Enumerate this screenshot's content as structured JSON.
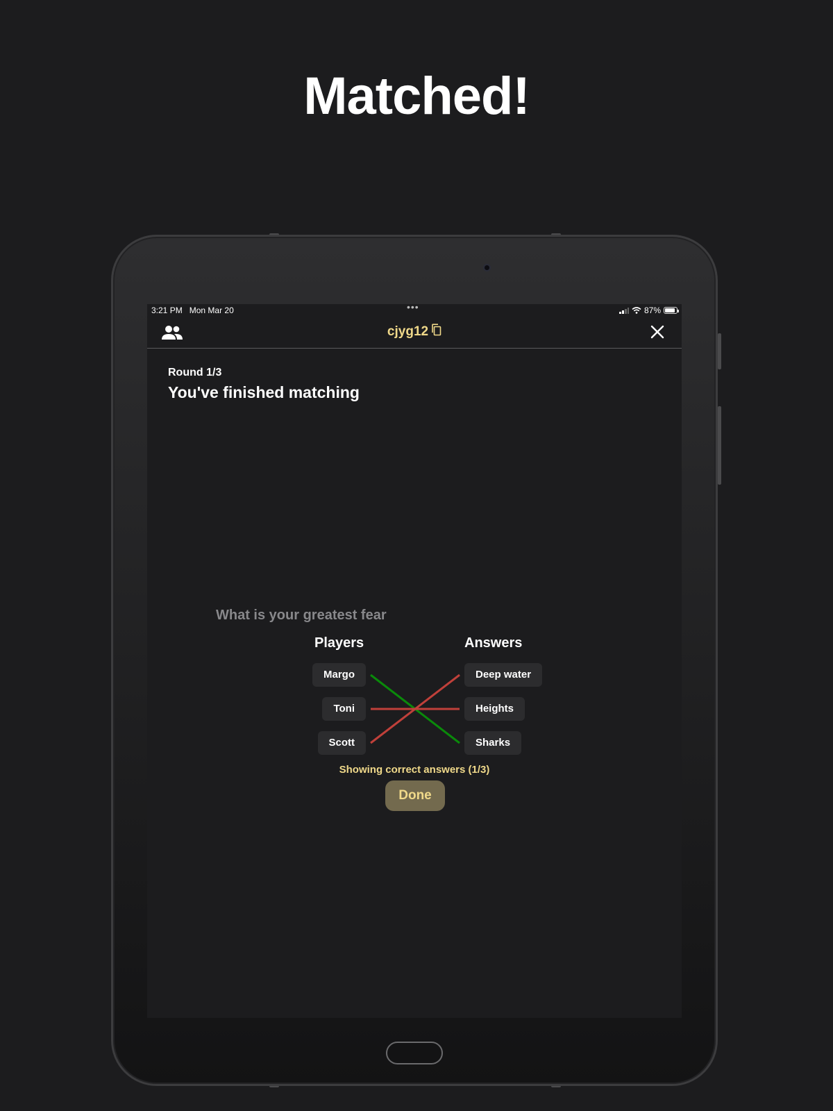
{
  "headline": "Matched!",
  "status_bar": {
    "time": "3:21 PM",
    "date": "Mon Mar 20",
    "battery": "87%",
    "icons": [
      "cellular-icon",
      "wifi-icon",
      "battery-icon"
    ]
  },
  "nav": {
    "room_code": "cjyg12",
    "icons": {
      "left": "players-icon",
      "code": "copy-icon",
      "right": "close-icon"
    }
  },
  "round": {
    "label": "Round 1/3",
    "title": "You've finished matching"
  },
  "match": {
    "question": "What is your greatest fear",
    "players_header": "Players",
    "answers_header": "Answers",
    "players": [
      "Margo",
      "Toni",
      "Scott"
    ],
    "answers": [
      "Deep water",
      "Heights",
      "Sharks"
    ],
    "links": [
      {
        "player": "Margo",
        "answer": "Sharks",
        "status": "correct"
      },
      {
        "player": "Toni",
        "answer": "Heights",
        "status": "incorrect"
      },
      {
        "player": "Scott",
        "answer": "Deep water",
        "status": "incorrect"
      }
    ],
    "colors": {
      "correct": "#0a8a0a",
      "incorrect": "#c0403a"
    },
    "correct_note": "Showing correct answers (1/3)",
    "done_label": "Done"
  },
  "colors": {
    "accent": "#f0d98a",
    "background": "#1c1c1e",
    "chip": "#2c2c2e",
    "button": "#736a4e"
  }
}
